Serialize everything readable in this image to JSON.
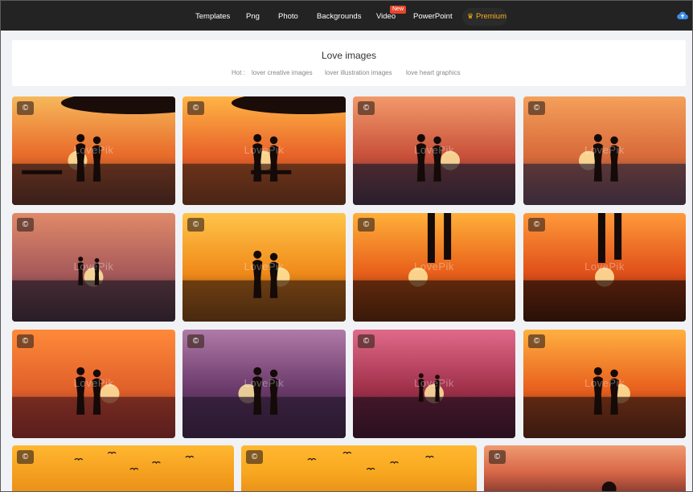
{
  "nav": {
    "items": [
      "Templates",
      "Png",
      "Photo",
      "Backgrounds",
      "Video",
      "PowerPoint"
    ],
    "video_badge": "New",
    "premium": "Premium",
    "premium_icon": "crown-icon",
    "upload_icon": "cloud-upload-icon"
  },
  "header": {
    "title": "Love images",
    "hot_label": "Hot :",
    "hot_links": [
      "lover creative images",
      "lover illustration images",
      "love heart graphics"
    ]
  },
  "grid": {
    "copyright_glyph": "©",
    "watermark": "LovePik",
    "cards": [
      {
        "scene": "couple on bench, tree, sunset"
      },
      {
        "scene": "couple on bench under tree, sunset"
      },
      {
        "scene": "couple kissing on beach"
      },
      {
        "scene": "couple walking in shallow sea"
      },
      {
        "scene": "couple far on beach with clouds"
      },
      {
        "scene": "couple embracing in water"
      },
      {
        "scene": "legs splashing water"
      },
      {
        "scene": "legs standing in water"
      },
      {
        "scene": "couple holding hands on grass"
      },
      {
        "scene": "couple on beach purple sky"
      },
      {
        "scene": "couple kissing on dunes"
      },
      {
        "scene": "couple kissing reflected in water"
      },
      {
        "scene": "birds flying orange sky"
      },
      {
        "scene": "birds flying orange sky"
      },
      {
        "scene": "couple on sunset beach"
      }
    ]
  },
  "colors": {
    "nav_bg": "#232323",
    "premium": "#f7b21a",
    "badge": "#e8452c",
    "page_bg": "#f0f2f5"
  }
}
